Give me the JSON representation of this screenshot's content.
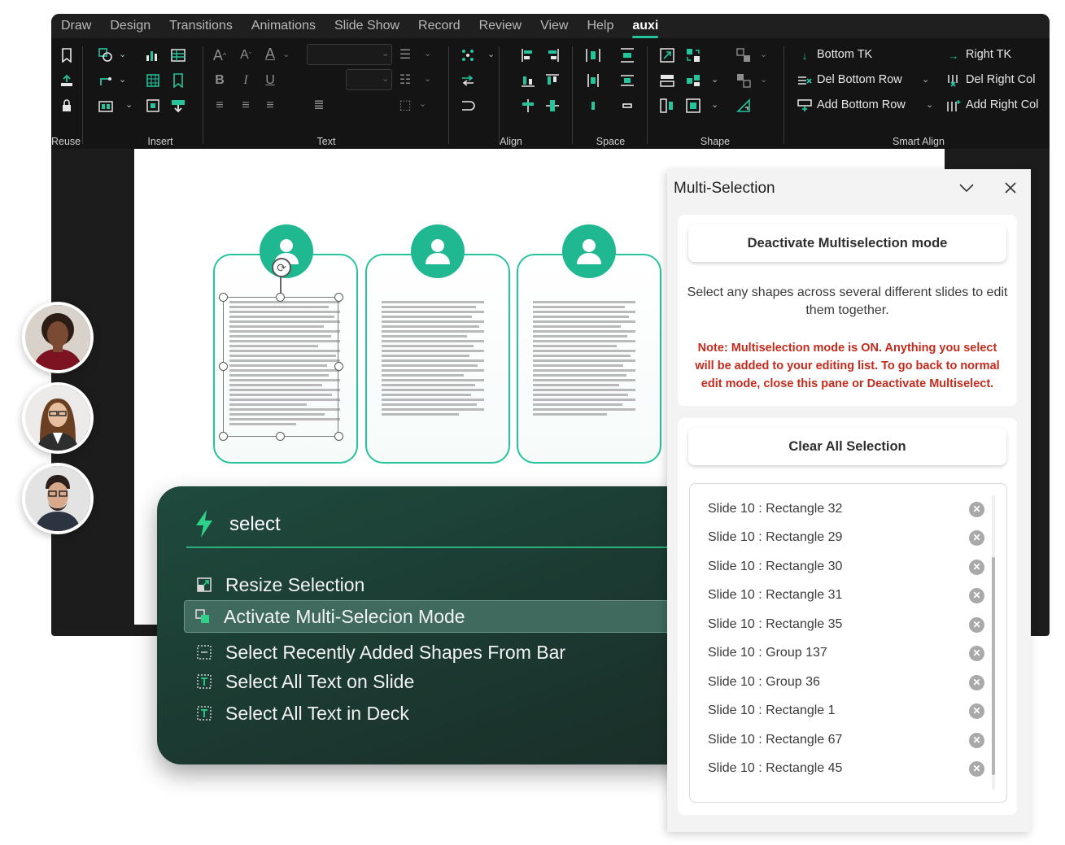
{
  "menu": {
    "tabs": [
      "Draw",
      "Design",
      "Transitions",
      "Animations",
      "Slide Show",
      "Record",
      "Review",
      "View",
      "Help",
      "auxi"
    ],
    "active_tab": "auxi"
  },
  "ribbon": {
    "groups": {
      "reuse": "Reuse",
      "insert": "Insert",
      "text": "Text",
      "align": "Align",
      "space": "Space",
      "shape": "Shape",
      "smart_align": "Smart Align"
    },
    "smart_align": {
      "bottom_tk": "Bottom TK",
      "del_bottom_row": "Del Bottom Row",
      "add_bottom_row": "Add Bottom Row",
      "right_tk": "Right TK",
      "del_right_col": "Del Right Col",
      "add_right_col": "Add Right Col"
    },
    "accent_color": "#26c49c"
  },
  "palette": {
    "query": "select",
    "items": [
      {
        "label": "Resize Selection",
        "icon": "resize-icon"
      },
      {
        "label": "Activate Multi-Selecion Mode",
        "icon": "multi-select-icon"
      },
      {
        "label": "Select Recently Added Shapes From Bar",
        "icon": "dashed-select-icon"
      },
      {
        "label": "Select All Text on Slide",
        "icon": "text-icon"
      },
      {
        "label": "Select All Text in Deck",
        "icon": "text-icon"
      }
    ],
    "highlighted_index": 1
  },
  "pane": {
    "title": "Multi-Selection",
    "deactivate_label": "Deactivate Multiselection mode",
    "description": "Select any shapes across several different slides to edit them together.",
    "note": "Note: Multiselection mode is ON. Anything you select will be added to your editing list. To go back to normal edit mode, close this pane or Deactivate Multiselect.",
    "clear_label": "Clear All Selection",
    "items": [
      "Slide 10 : Rectangle 32",
      "Slide 10 : Rectangle 29",
      "Slide 10 : Rectangle 30",
      "Slide 10 : Rectangle 31",
      "Slide 10 : Rectangle 35",
      "Slide 10 : Group 137",
      "Slide 10 : Group 36",
      "Slide 10 : Rectangle 1",
      "Slide 10 : Rectangle 67",
      "Slide 10 : Rectangle 45"
    ]
  }
}
